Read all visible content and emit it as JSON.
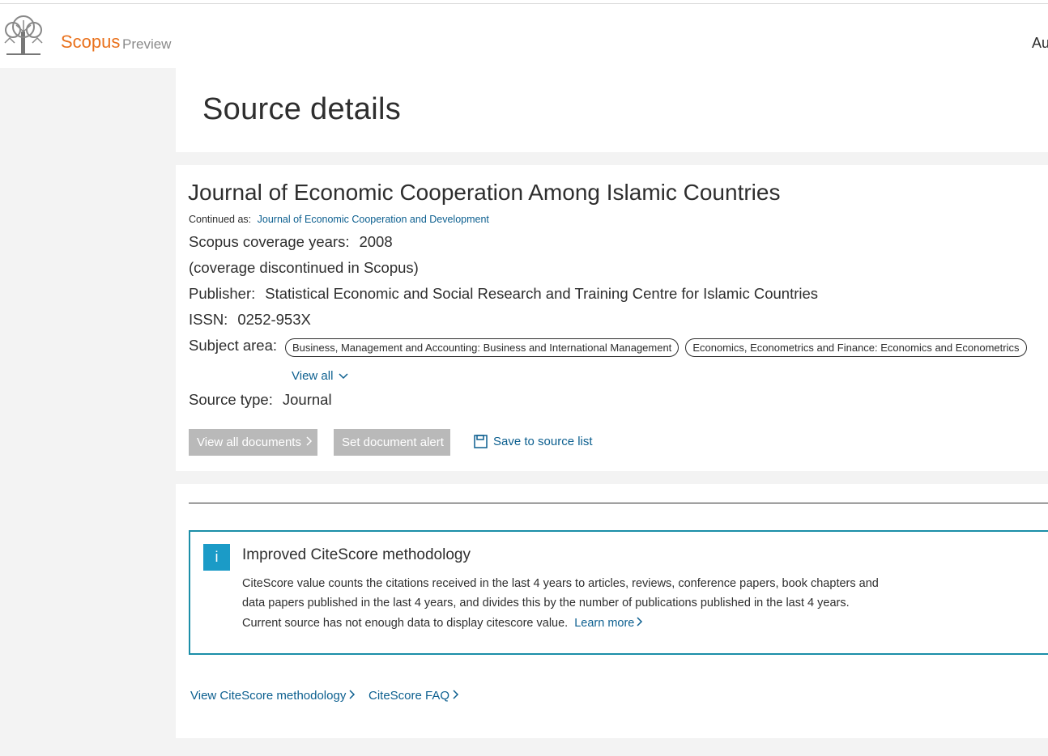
{
  "header": {
    "brand": "Scopus",
    "brand_sub": "Preview",
    "nav_right": "Au"
  },
  "page_title": "Source details",
  "source": {
    "title": "Journal of Economic Cooperation Among Islamic Countries",
    "continued_label": "Continued as:",
    "continued_link": "Journal of Economic Cooperation and Development",
    "coverage_label": "Scopus coverage years:",
    "coverage_value": "2008",
    "coverage_note": "(coverage discontinued in Scopus)",
    "publisher_label": "Publisher:",
    "publisher_value": "Statistical Economic and Social Research and Training Centre for Islamic Countries",
    "issn_label": "ISSN:",
    "issn_value": "0252-953X",
    "subject_label": "Subject area:",
    "subjects": [
      "Business, Management and Accounting: Business and International Management",
      "Economics, Econometrics and Finance: Economics and Econometrics"
    ],
    "view_all": "View all",
    "type_label": "Source type:",
    "type_value": "Journal",
    "btn_view_docs": "View all documents",
    "btn_alert": "Set document alert",
    "save_link": "Save to source list"
  },
  "citescore": {
    "info_icon": "i",
    "title": "Improved CiteScore methodology",
    "text": "CiteScore value counts the citations received in the last 4 years to articles, reviews, conference papers, book chapters and data papers published in the last 4 years, and divides this by the number of publications published in the last 4 years.",
    "note": "Current source has not enough data to display citescore value.",
    "learn_more": "Learn more",
    "link_methodology": "View CiteScore methodology",
    "link_faq": "CiteScore FAQ"
  },
  "colors": {
    "brand": "#e9711c",
    "link": "#0c5f8f",
    "info_border": "#1b8ea8",
    "button_disabled": "#b9b9b9"
  }
}
